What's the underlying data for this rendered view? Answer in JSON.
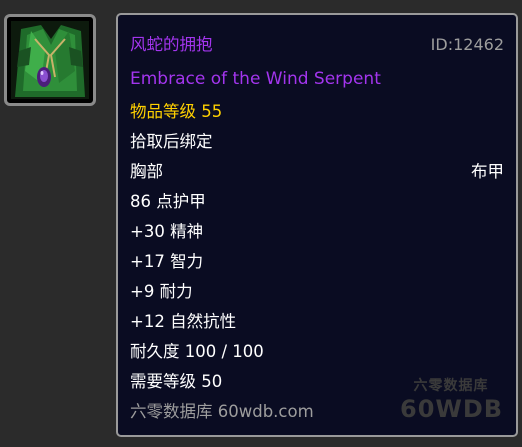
{
  "item": {
    "icon": "green-robe-icon",
    "name_cn": "风蛇的拥抱",
    "id_text": "ID:12462",
    "name_en": "Embrace of the Wind Serpent",
    "item_level": "物品等级 55",
    "bind": "拾取后绑定",
    "slot": "胸部",
    "armor_type": "布甲",
    "armor": "86 点护甲",
    "stats": [
      "+30 精神",
      "+17 智力",
      "+9 耐力",
      "+12 自然抗性"
    ],
    "durability": "耐久度 100 / 100",
    "required_level": "需要等级 50",
    "source": "六零数据库 60wdb.com"
  },
  "watermark": {
    "cn": "六零数据库",
    "en": "60WDB"
  },
  "colors": {
    "epic": "#a335ee",
    "item_level": "#ffd100",
    "muted": "#9d9d9d",
    "tooltip_bg": "#0a0c22"
  }
}
